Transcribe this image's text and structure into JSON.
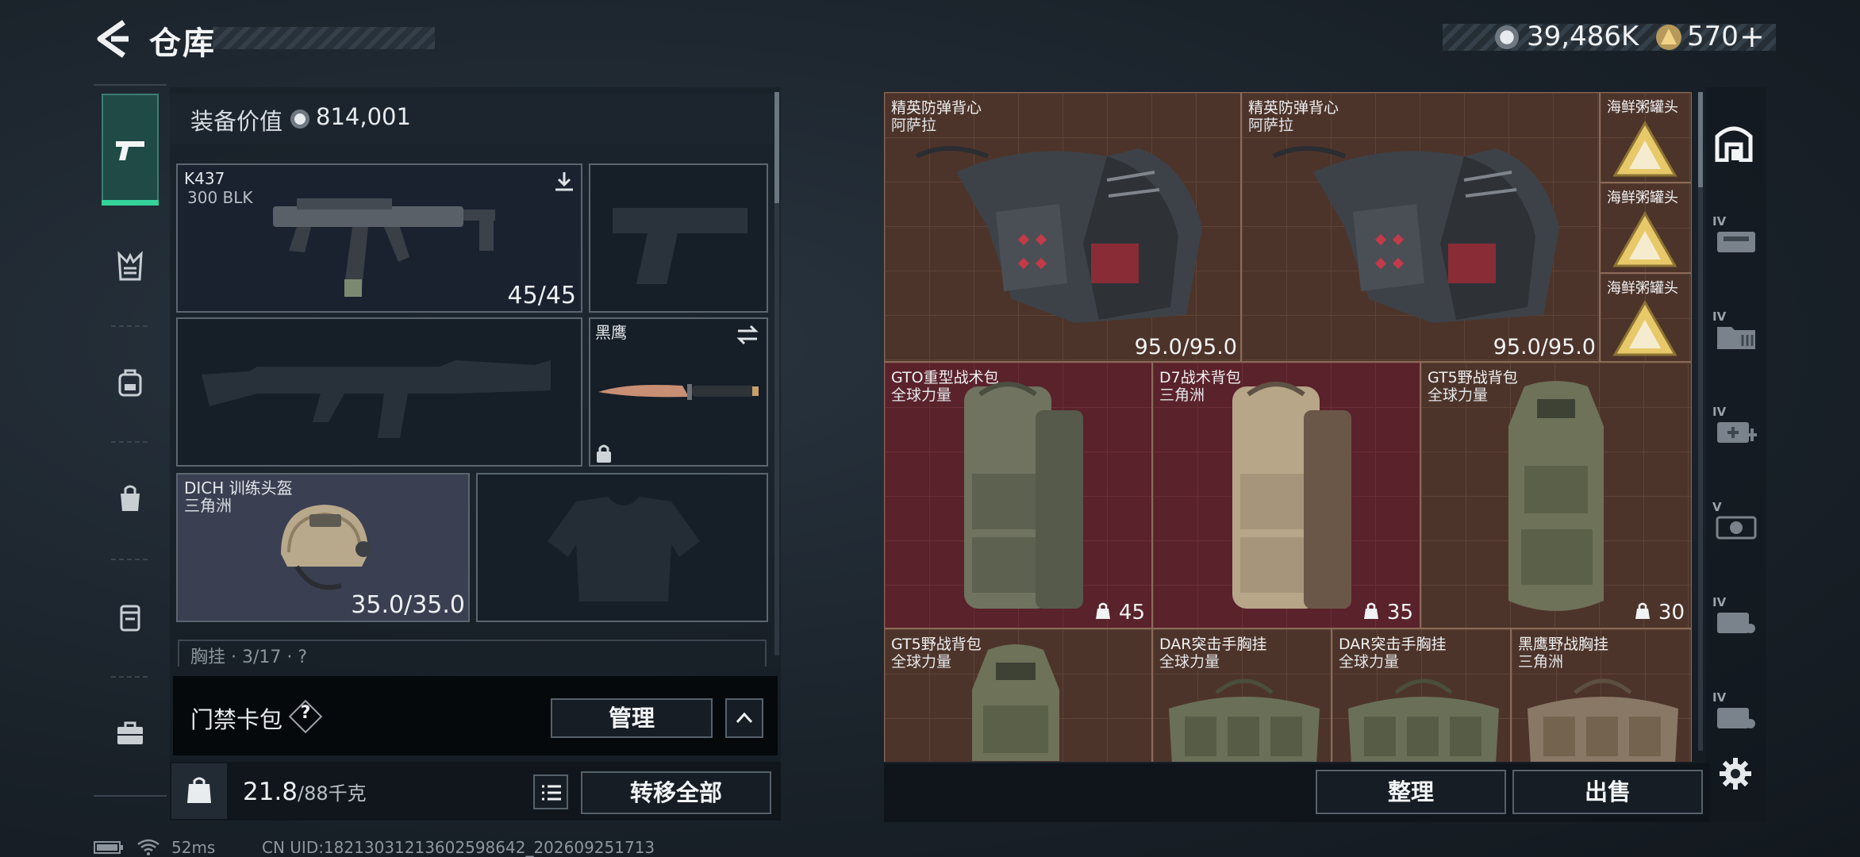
{
  "header": {
    "title": "仓库"
  },
  "currency": {
    "hafcoin": "39,486K",
    "bonds": "570",
    "bonds_plus": "+"
  },
  "equipment": {
    "value_label": "装备价值",
    "value": "814,001",
    "primary_weapon": {
      "name": "K437",
      "ammo": "300 BLK",
      "durability": "45/45"
    },
    "melee": {
      "name": "黑鹰"
    },
    "helmet": {
      "name": "DICH 训练头盔",
      "source": "三角洲",
      "durability": "35.0/35.0"
    },
    "chest_partial": "胸挂 · 3/17 · ?"
  },
  "access_card": {
    "label": "门禁卡包",
    "help": "?",
    "manage": "管理"
  },
  "weight": {
    "current": "21.8",
    "max": "/88千克"
  },
  "transfer_all": "转移全部",
  "storage": {
    "items": [
      {
        "name": "精英防弹背心",
        "source": "阿萨拉",
        "value": "95.0/95.0"
      },
      {
        "name": "精英防弹背心",
        "source": "阿萨拉",
        "value": "95.0/95.0"
      },
      {
        "name": "海鲜粥罐头"
      },
      {
        "name": "海鲜粥罐头"
      },
      {
        "name": "海鲜粥罐头"
      },
      {
        "name": "GTO重型战术包",
        "source": "全球力量",
        "count": "45"
      },
      {
        "name": "D7战术背包",
        "source": "三角洲",
        "count": "35"
      },
      {
        "name": "GT5野战背包",
        "source": "全球力量",
        "count": "30"
      },
      {
        "name": "GT5野战背包",
        "source": "全球力量"
      },
      {
        "name": "DAR突击手胸挂",
        "source": "全球力量"
      },
      {
        "name": "DAR突击手胸挂",
        "source": "全球力量"
      },
      {
        "name": "黑鹰野战胸挂",
        "source": "三角洲"
      }
    ],
    "sort_button": "整理",
    "sell_button": "出售"
  },
  "right_tabs": [
    {
      "label": "IV"
    },
    {
      "label": "IV"
    },
    {
      "label": "IV"
    },
    {
      "label": "V"
    },
    {
      "label": "IV"
    },
    {
      "label": "IV"
    }
  ],
  "status": {
    "ping": "52ms",
    "uid": "CN UID:18213031213602598642_202609251713"
  },
  "colors": {
    "accent_green": "#33d39a",
    "storage_bg": "#4d342a",
    "storage_red": "#5a222b"
  }
}
